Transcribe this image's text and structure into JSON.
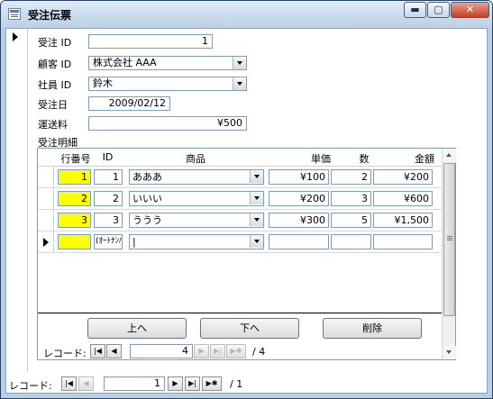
{
  "window": {
    "title": "受注伝票"
  },
  "form": {
    "order_id": {
      "label": "受注 ID",
      "value": "1"
    },
    "customer_id": {
      "label": "顧客 ID",
      "value": "株式会社 AAA"
    },
    "employee_id": {
      "label": "社員 ID",
      "value": "鈴木"
    },
    "order_date": {
      "label": "受注日",
      "value": "2009/02/12"
    },
    "shipping": {
      "label": "運送料",
      "value": "¥500"
    },
    "details_label": "受注明細"
  },
  "subform": {
    "headers": [
      "行番号",
      "ID",
      "商品",
      "単価",
      "数",
      "金額"
    ],
    "rows": [
      {
        "line": "1",
        "id": "1",
        "product": "あああ",
        "price": "¥100",
        "qty": "2",
        "amount": "¥200"
      },
      {
        "line": "2",
        "id": "2",
        "product": "いいい",
        "price": "¥200",
        "qty": "3",
        "amount": "¥600"
      },
      {
        "line": "3",
        "id": "3",
        "product": "ううう",
        "price": "¥300",
        "qty": "5",
        "amount": "¥1,500"
      }
    ],
    "new_row": {
      "line": "",
      "id": "(ｵｰﾄﾅﾝﾊﾞｰ)",
      "product": "|",
      "price": "",
      "qty": "",
      "amount": ""
    },
    "buttons": {
      "up": "上へ",
      "down": "下へ",
      "delete": "削除"
    },
    "nav": {
      "label": "レコード:",
      "current": "4",
      "total": "/ 4"
    }
  },
  "main_nav": {
    "label": "レコード:",
    "current": "1",
    "total": "/ 1"
  },
  "icons": {
    "minimize": "minimize-icon",
    "maximize": "maximize-icon",
    "close": "close-icon",
    "first": "first-record-icon",
    "prev": "previous-record-icon",
    "next": "next-record-icon",
    "last": "last-record-icon",
    "new": "new-record-icon"
  }
}
